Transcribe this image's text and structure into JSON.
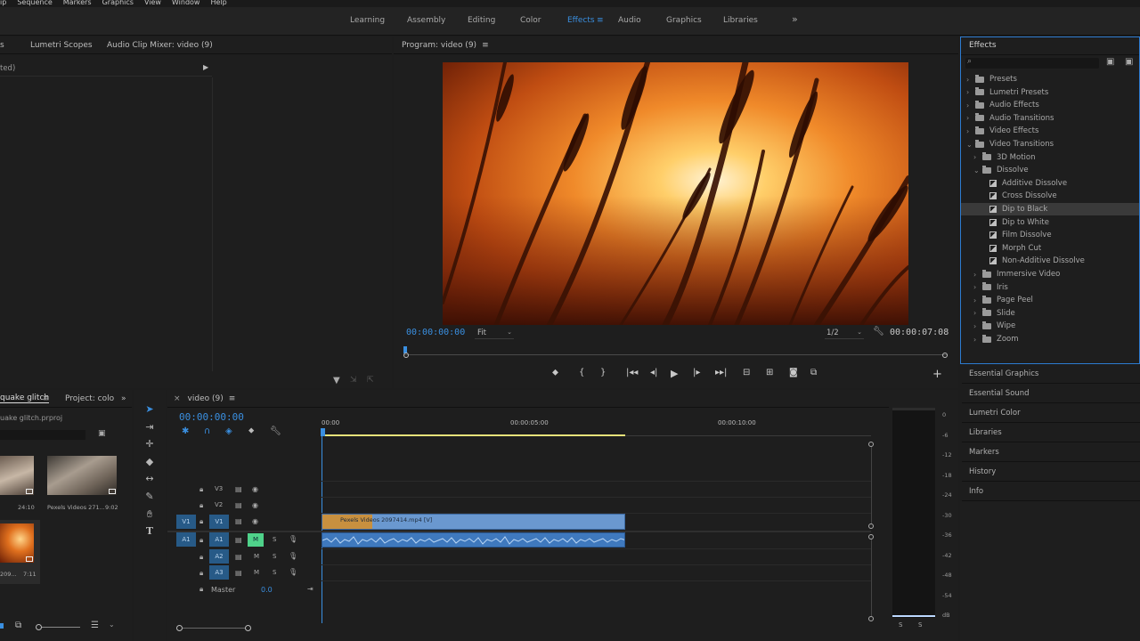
{
  "menu": [
    "ip",
    "Sequence",
    "Markers",
    "Graphics",
    "View",
    "Window",
    "Help"
  ],
  "workspaces": [
    "Learning",
    "Assembly",
    "Editing",
    "Color",
    "Effects",
    "Audio",
    "Graphics",
    "Libraries"
  ],
  "workspace_active": "Effects",
  "workspace_overflow": "»",
  "source_panel": {
    "tabs": [
      "s",
      "Lumetri Scopes",
      "Audio Clip Mixer: video (9)"
    ],
    "dropdown": "ted)"
  },
  "program": {
    "title": "Program: video (9)",
    "timecode": "00:00:00:00",
    "fit": "Fit",
    "resolution": "1/2",
    "duration": "00:00:07:08"
  },
  "effects": {
    "title": "Effects",
    "search_placeholder": "",
    "tree": [
      {
        "label": "Presets",
        "type": "folder",
        "level": 0,
        "expanded": false
      },
      {
        "label": "Lumetri Presets",
        "type": "folder",
        "level": 0,
        "expanded": false
      },
      {
        "label": "Audio Effects",
        "type": "folder",
        "level": 0,
        "expanded": false
      },
      {
        "label": "Audio Transitions",
        "type": "folder",
        "level": 0,
        "expanded": false
      },
      {
        "label": "Video Effects",
        "type": "folder",
        "level": 0,
        "expanded": false
      },
      {
        "label": "Video Transitions",
        "type": "folder",
        "level": 0,
        "expanded": true
      },
      {
        "label": "3D Motion",
        "type": "folder",
        "level": 1,
        "expanded": false
      },
      {
        "label": "Dissolve",
        "type": "folder",
        "level": 1,
        "expanded": true
      },
      {
        "label": "Additive Dissolve",
        "type": "effect",
        "level": 2
      },
      {
        "label": "Cross Dissolve",
        "type": "effect",
        "level": 2
      },
      {
        "label": "Dip to Black",
        "type": "effect",
        "level": 2,
        "selected": true
      },
      {
        "label": "Dip to White",
        "type": "effect",
        "level": 2
      },
      {
        "label": "Film Dissolve",
        "type": "effect",
        "level": 2
      },
      {
        "label": "Morph Cut",
        "type": "effect",
        "level": 2
      },
      {
        "label": "Non-Additive Dissolve",
        "type": "effect",
        "level": 2
      },
      {
        "label": "Immersive Video",
        "type": "folder",
        "level": 1,
        "expanded": false
      },
      {
        "label": "Iris",
        "type": "folder",
        "level": 1,
        "expanded": false
      },
      {
        "label": "Page Peel",
        "type": "folder",
        "level": 1,
        "expanded": false
      },
      {
        "label": "Slide",
        "type": "folder",
        "level": 1,
        "expanded": false
      },
      {
        "label": "Wipe",
        "type": "folder",
        "level": 1,
        "expanded": false
      },
      {
        "label": "Zoom",
        "type": "folder",
        "level": 1,
        "expanded": false
      }
    ]
  },
  "side_panels": [
    "Essential Graphics",
    "Essential Sound",
    "Lumetri Color",
    "Libraries",
    "Markers",
    "History",
    "Info"
  ],
  "project": {
    "tabs": [
      "quake glitch",
      "Project: colo"
    ],
    "file": "uake glitch.prproj",
    "items": [
      {
        "name": "",
        "duration": "24:10"
      },
      {
        "name": "Pexels Videos 271...",
        "duration": "9:02"
      },
      {
        "name": "209...",
        "duration": "7:11"
      }
    ]
  },
  "timeline": {
    "title": "video (9)",
    "timecode": "00:00:00:00",
    "ruler": [
      "00:00",
      "00:00:05:00",
      "00:00:10:00"
    ],
    "tracks_video": [
      "V3",
      "V2",
      "V1"
    ],
    "tracks_audio": [
      "A1",
      "A2",
      "A3"
    ],
    "master_label": "Master",
    "master_value": "0.0",
    "clip_label": "Pexels Videos 2097414.mp4 [V]",
    "source_v": "V1",
    "source_a": "A1"
  },
  "meter": {
    "labels": [
      "0",
      "-6",
      "-12",
      "-18",
      "-24",
      "-30",
      "-36",
      "-42",
      "-48",
      "-54",
      "dB"
    ],
    "solo": [
      "S",
      "S"
    ]
  },
  "colors": {
    "accent": "#3a8fe0",
    "clip_video": "#5b8ac4",
    "clip_audio": "#3f79be",
    "mute_active": "#4fd28a"
  }
}
